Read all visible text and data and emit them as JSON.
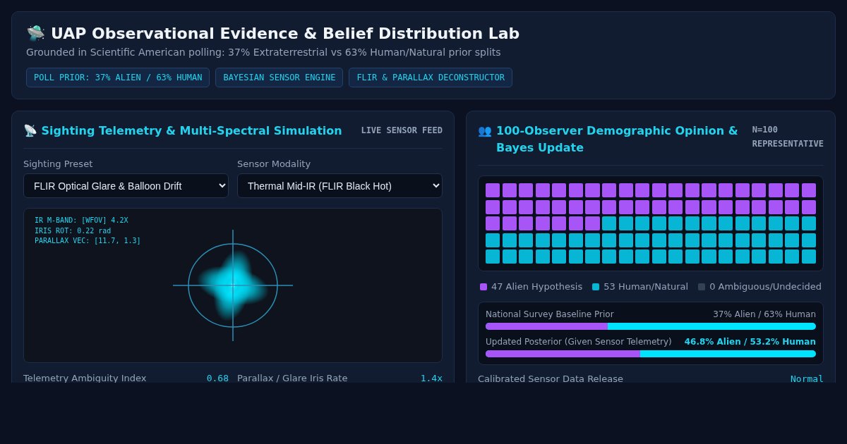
{
  "header": {
    "icon": "🛸",
    "title": "UAP Observational Evidence & Belief Distribution Lab",
    "subtitle": "Grounded in Scientific American polling: 37% Extraterrestrial vs 63% Human/Natural prior splits",
    "tags": [
      "POLL PRIOR: 37% ALIEN / 63% HUMAN",
      "BAYESIAN SENSOR ENGINE",
      "FLIR & PARALLAX DECONSTRUCTOR"
    ]
  },
  "telemetry_panel": {
    "icon": "📡",
    "title": "Sighting Telemetry & Multi-Spectral Simulation",
    "badge": "LIVE SENSOR FEED",
    "fields": [
      {
        "label": "Sighting Preset",
        "value": "FLIR Optical Glare & Balloon Drift"
      },
      {
        "label": "Sensor Modality",
        "value": "Thermal Mid-IR (FLIR Black Hot)"
      }
    ],
    "overlay_lines": [
      "IR M-BAND: [WFOV] 4.2X",
      "IRIS ROT: 0.22 rad",
      "PARALLAX VEC: [11.7, 1.3]"
    ],
    "stats": [
      {
        "label": "Telemetry Ambiguity Index",
        "value": "0.68"
      },
      {
        "label": "Parallax / Glare Iris Rate",
        "value": "1.4x"
      }
    ]
  },
  "opinion_panel": {
    "icon": "👥",
    "title": "100-Observer Demographic Opinion & Bayes Update",
    "badge": "N=100 REPRESENTATIVE",
    "legend": [
      {
        "count": "47",
        "label": "Alien Hypothesis",
        "color": "#a855f7"
      },
      {
        "count": "53",
        "label": "Human/Natural",
        "color": "#06b6d4"
      },
      {
        "count": "0",
        "label": "Ambiguous/Undecided",
        "color": "#334155"
      }
    ],
    "bars": [
      {
        "label": "National Survey Baseline Prior",
        "value": "37% Alien / 63% Human",
        "level": 0.37,
        "emphasized": false
      },
      {
        "label": "Updated Posterior (Given Sensor Telemetry)",
        "value": "46.8% Alien / 53.2% Human",
        "level": 0.468,
        "emphasized": true
      }
    ],
    "stats": [
      {
        "label": "Calibrated Sensor Data Release",
        "value": "Normal"
      }
    ]
  }
}
